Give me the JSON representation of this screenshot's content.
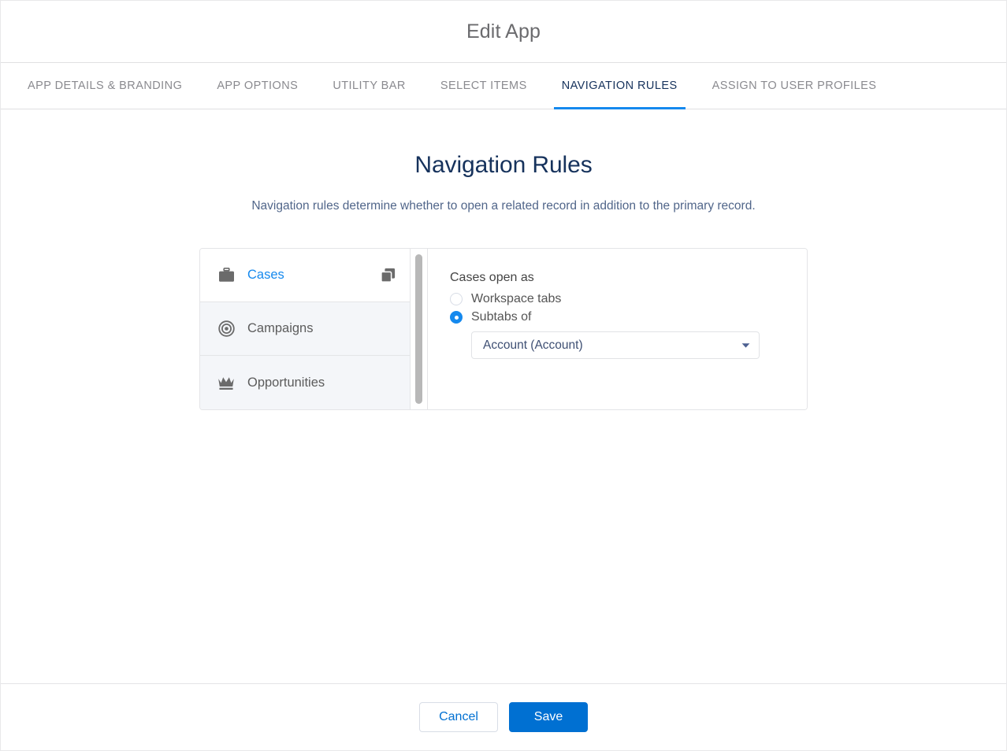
{
  "window": {
    "title": "Edit App"
  },
  "tabs": [
    {
      "label": "APP DETAILS & BRANDING",
      "active": false
    },
    {
      "label": "APP OPTIONS",
      "active": false
    },
    {
      "label": "UTILITY BAR",
      "active": false
    },
    {
      "label": "SELECT ITEMS",
      "active": false
    },
    {
      "label": "NAVIGATION RULES",
      "active": true
    },
    {
      "label": "ASSIGN TO USER PROFILES",
      "active": false
    }
  ],
  "page": {
    "heading": "Navigation Rules",
    "description": "Navigation rules determine whether to open a related record in addition to the primary record."
  },
  "item_list": [
    {
      "label": "Cases",
      "icon": "briefcase-icon",
      "selected": true,
      "badge": "copy-icon"
    },
    {
      "label": "Campaigns",
      "icon": "target-icon",
      "selected": false,
      "badge": null
    },
    {
      "label": "Opportunities",
      "icon": "crown-icon",
      "selected": false,
      "badge": null
    }
  ],
  "detail": {
    "title": "Cases open as",
    "options": [
      {
        "label": "Workspace tabs",
        "checked": false
      },
      {
        "label": "Subtabs of",
        "checked": true
      }
    ],
    "select": {
      "value": "Account (Account)",
      "options": [
        "Account (Account)"
      ]
    }
  },
  "footer": {
    "cancel_label": "Cancel",
    "save_label": "Save"
  },
  "colors": {
    "accent_blue": "#1589ee",
    "primary_button": "#0070d2",
    "active_tab_text": "#16325c",
    "heading": "#16325c",
    "description": "#51668a",
    "inactive_tab_text": "#8a8a8f"
  }
}
